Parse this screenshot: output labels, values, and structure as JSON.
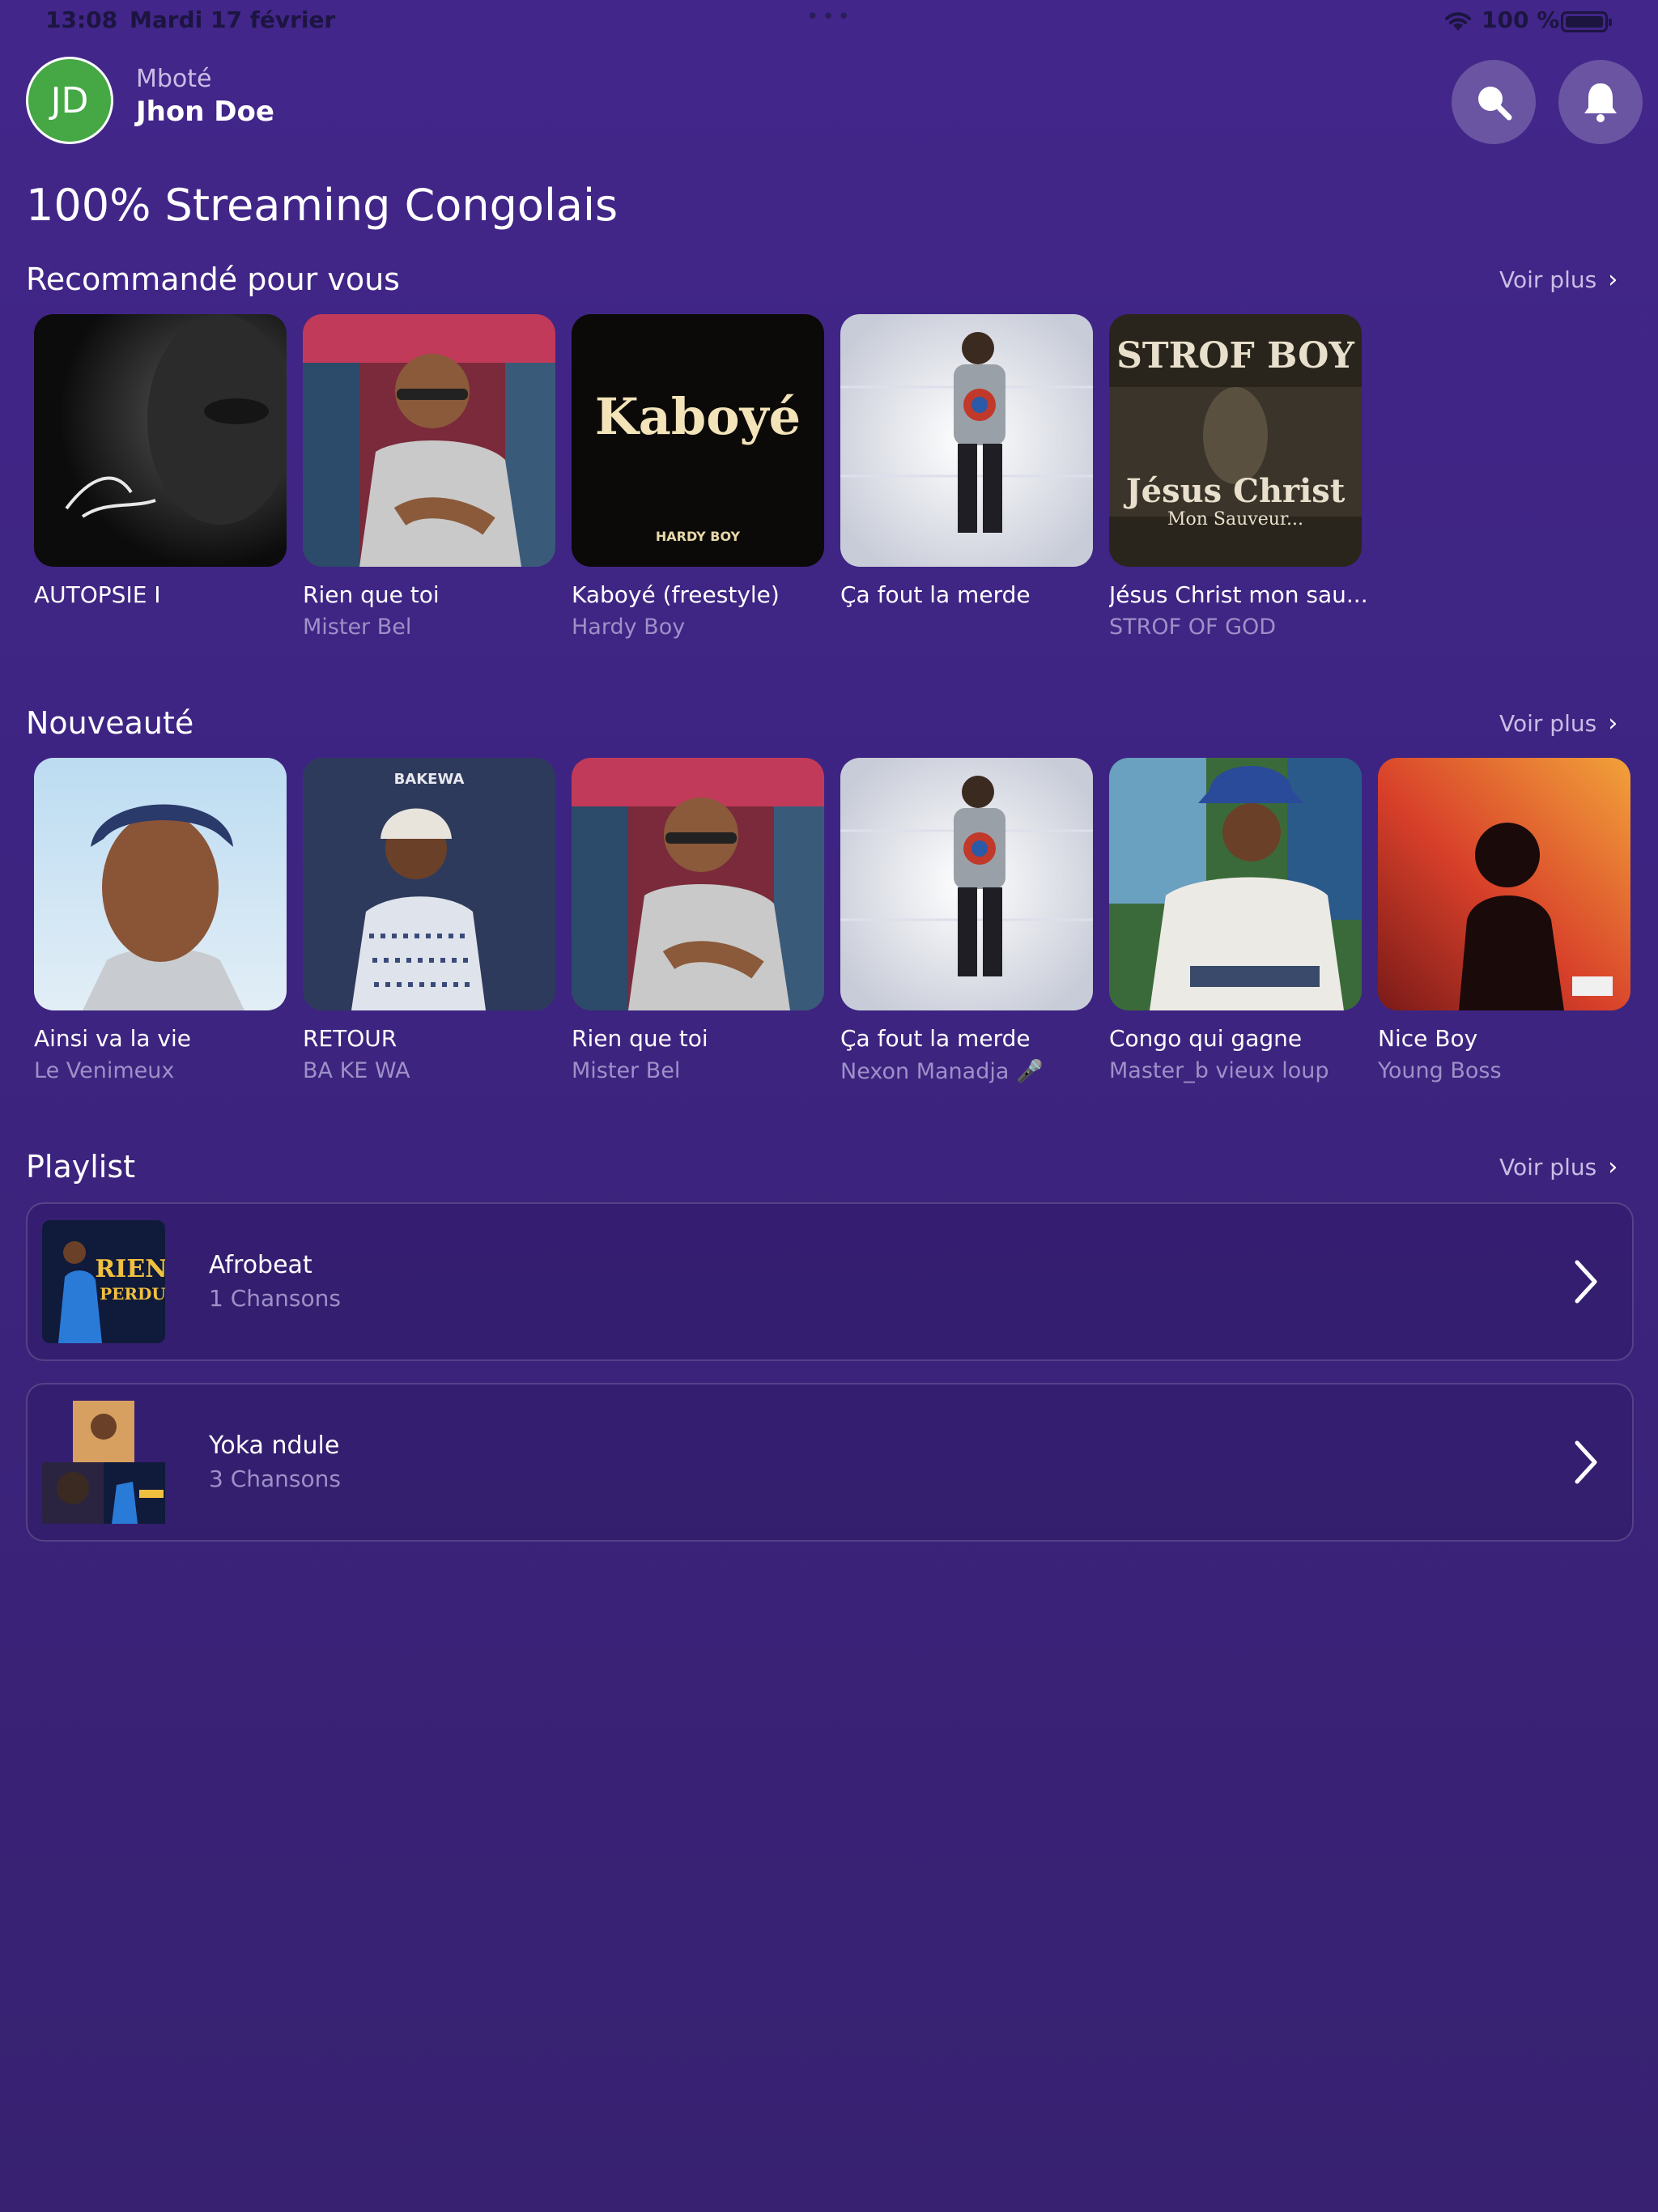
{
  "status_bar": {
    "time": "13:08",
    "date": "Mardi 17 février",
    "battery": "100 %",
    "dots": "•••"
  },
  "header": {
    "avatar_initials": "JD",
    "greeting": "Mboté",
    "username": "Jhon Doe",
    "search_icon": "search-icon",
    "bell_icon": "bell-icon"
  },
  "page_title": "100% Streaming Congolais",
  "see_more": "Voir plus",
  "recommended": {
    "title": "Recommandé pour vous",
    "items": [
      {
        "title": "AUTOPSIE I",
        "artist": ""
      },
      {
        "title": "Rien que toi",
        "artist": "Mister Bel"
      },
      {
        "title": "Kaboyé (freestyle)",
        "artist": "Hardy Boy",
        "cover_text": "Kaboyé",
        "cover_sub": "HARDY BOY"
      },
      {
        "title": "Ça fout la merde",
        "artist": ""
      },
      {
        "title": "Jésus Christ mon sau...",
        "artist": "STROF OF GOD",
        "cover_text": "STROF BOY",
        "cover_sub": "Jésus Christ",
        "cover_sub2": "Mon Sauveur..."
      }
    ]
  },
  "new": {
    "title": "Nouveauté",
    "items": [
      {
        "title": "Ainsi va la vie",
        "artist": "Le Venimeux"
      },
      {
        "title": "RETOUR",
        "artist": "BA KE WA",
        "cover_text": "BAKEWA"
      },
      {
        "title": "Rien que toi",
        "artist": "Mister Bel"
      },
      {
        "title": "Ça fout la merde",
        "artist": "Nexon Manadja 🎤"
      },
      {
        "title": "Congo qui gagne",
        "artist": "Master_b vieux loup"
      },
      {
        "title": "Nice Boy",
        "artist": "Young Boss"
      }
    ]
  },
  "playlist": {
    "title": "Playlist",
    "items": [
      {
        "name": "Afrobeat",
        "count": "1 Chansons",
        "cover_text": "RIEN",
        "cover_sub": "PERDU"
      },
      {
        "name": "Yoka ndule",
        "count": "3 Chansons"
      }
    ]
  },
  "colors": {
    "background": "#42268a",
    "avatar": "#45a845",
    "muted_text": "#9e90c8"
  }
}
